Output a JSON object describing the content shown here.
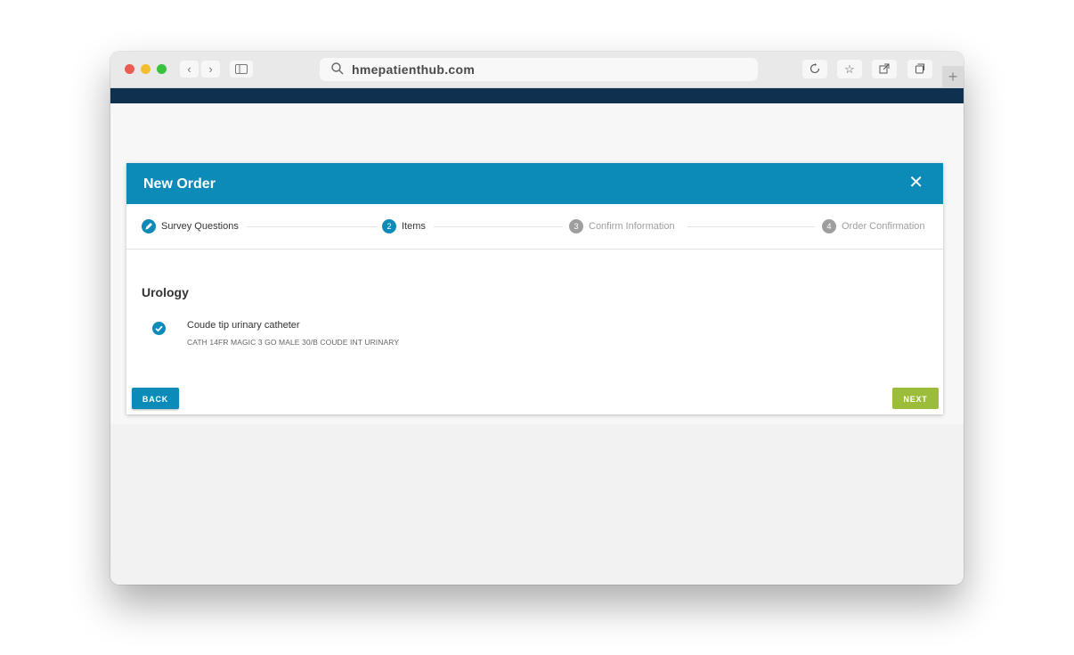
{
  "browser": {
    "url": "hmepatienthub.com",
    "nav_back": "‹",
    "nav_forward": "›",
    "new_tab": "+"
  },
  "dialog": {
    "title": "New Order",
    "close_label": "✕"
  },
  "stepper": {
    "steps": [
      {
        "number": "",
        "label": "Survey Questions",
        "state": "completed"
      },
      {
        "number": "2",
        "label": "Items",
        "state": "active"
      },
      {
        "number": "3",
        "label": "Confirm Information",
        "state": "pending"
      },
      {
        "number": "4",
        "label": "Order Confirmation",
        "state": "pending"
      }
    ]
  },
  "content": {
    "section_title": "Urology",
    "items": [
      {
        "name": "Coude tip urinary catheter",
        "description": "CATH 14FR MAGIC 3 GO MALE 30/B COUDE INT URINARY",
        "selected": true
      }
    ]
  },
  "actions": {
    "back_label": "BACK",
    "next_label": "NEXT"
  },
  "colors": {
    "header": "#0c8ab8",
    "site_bar": "#10304f",
    "next_button": "#9cbd3a",
    "pending_step": "#9e9e9e"
  }
}
